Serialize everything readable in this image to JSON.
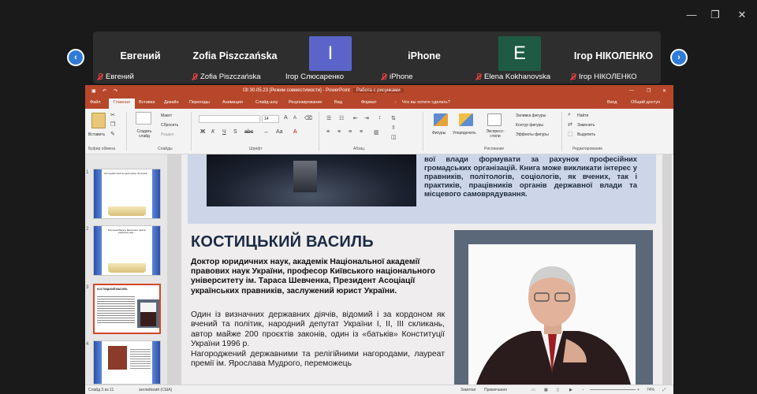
{
  "window_controls": {
    "minimize": "—",
    "restore": "❐",
    "close": "✕"
  },
  "gallery": {
    "prev_arrow": "‹",
    "next_arrow": "›",
    "participants": [
      {
        "display": "Евгений",
        "label": "Евгений",
        "muted": true
      },
      {
        "display": "Zofia Piszczańska",
        "label": "Zofia Piszczańska",
        "muted": true
      },
      {
        "display": "I",
        "label": "Ігор Слюсаренко",
        "muted": false,
        "avatar_color": "#5b65c9"
      },
      {
        "display": "iPhone",
        "label": "iPhone",
        "muted": true
      },
      {
        "display": "E",
        "label": "Elena Kokhanovska",
        "muted": true,
        "avatar_color": "#1e5a44"
      },
      {
        "display": "Ігор НІКОЛЕНКО",
        "label": "Ігор НІКОЛЕНКО",
        "muted": true
      }
    ]
  },
  "ppt": {
    "title": "ІЗІ 30.05.23 [Режим совместимости] - PowerPoint",
    "context_tab_group": "Работа с рисунками",
    "tabs": [
      "Файл",
      "Главная",
      "Вставка",
      "Дизайн",
      "Переходы",
      "Анимация",
      "Слайд-шоу",
      "Рецензирование",
      "Вид",
      "Формат"
    ],
    "tell_me": "Что вы хотите сделать?",
    "sign_in": "Вход",
    "share": "Общий доступ",
    "ribbon": {
      "paste": "Вставить",
      "new_slide": "Создать слайд",
      "layout": "Макет",
      "reset": "Сбросить",
      "section": "Раздел",
      "font_size": "14",
      "shapes": "Фигуры",
      "arrange": "Упорядочить",
      "quick_styles": "Экспресс-стили",
      "shape_fill": "Заливка фигуры",
      "shape_outline": "Контур фигуры",
      "shape_effects": "Эффекты фигуры",
      "find": "Найти",
      "replace": "Заменить",
      "select": "Выделить",
      "groups": [
        "Буфер обмена",
        "Слайды",
        "Шрифт",
        "Абзац",
        "Рисование",
        "Редактирование"
      ]
    },
    "thumbs": [
      {
        "num": "1",
        "text": "Костицький герой не однієї країни. Фотограф. ..."
      },
      {
        "num": "2",
        "text": "Костицький Василь Васильович. Доктор юридичних наук ..."
      },
      {
        "num": "3",
        "text": "КОСТИЦЬКИЙ ВАСИЛЬ"
      },
      {
        "num": "4",
        "text": ""
      }
    ],
    "slide": {
      "top_text": "вої влади формувати за рахунок професійних громадських організацій. Книга може викликати інтерес у правників, політологів, соціологів, як вчених, так і практиків, працівників органів державної влади та місцевого самоврядування.",
      "heading": "КОСТИЦЬКИЙ ВАСИЛЬ",
      "subtitle": "Доктор юридичних наук, академік Національної академії правових наук України, професор Київського національного університету ім. Тараса Шевченка, Президент Асоціації українських правників, заслужений юрист України.",
      "body1": "Один із визначних державних діячів, відомий і за кордоном як вчений та політик, народний депутат України I, II, III скликань, автор майже 200 проєктів законів, один із «батьків» Конституції України 1996 р.",
      "body2": "Нагороджений державними та релігійними нагородами, лауреат премії ім. Ярослава Мудрого, переможець"
    },
    "status": {
      "slide_of": "Слайд 3 из 11",
      "language": "английский (США)",
      "notes": "Заметки",
      "comments": "Примечания",
      "zoom": "74%"
    }
  }
}
